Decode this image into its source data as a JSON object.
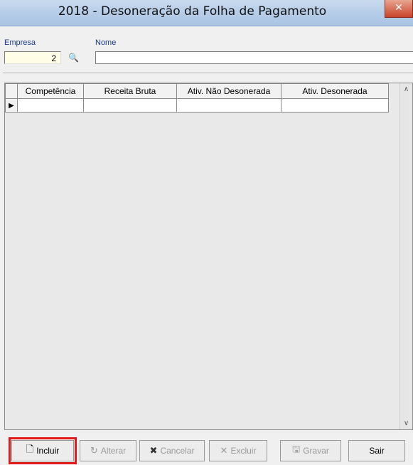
{
  "window": {
    "title": "2018 - Desoneração da Folha de Pagamento",
    "close_glyph": "✕"
  },
  "filters": {
    "empresa_label": "Empresa",
    "empresa_value": "2",
    "nome_label": "Nome",
    "nome_value": "",
    "search_icon": "binoculars-icon"
  },
  "grid": {
    "columns": [
      "Competência",
      "Receita Bruta",
      "Ativ. Não Desonerada",
      "Ativ. Desonerada"
    ],
    "rows": [
      {
        "competencia": "",
        "receita_bruta": "",
        "ativ_nao_desonerada": "",
        "ativ_desonerada": ""
      }
    ],
    "row_indicator": "▶"
  },
  "toolbar": {
    "incluir": "Incluir",
    "alterar": "Alterar",
    "cancelar": "Cancelar",
    "excluir": "Excluir",
    "gravar": "Gravar",
    "sair": "Sair"
  }
}
